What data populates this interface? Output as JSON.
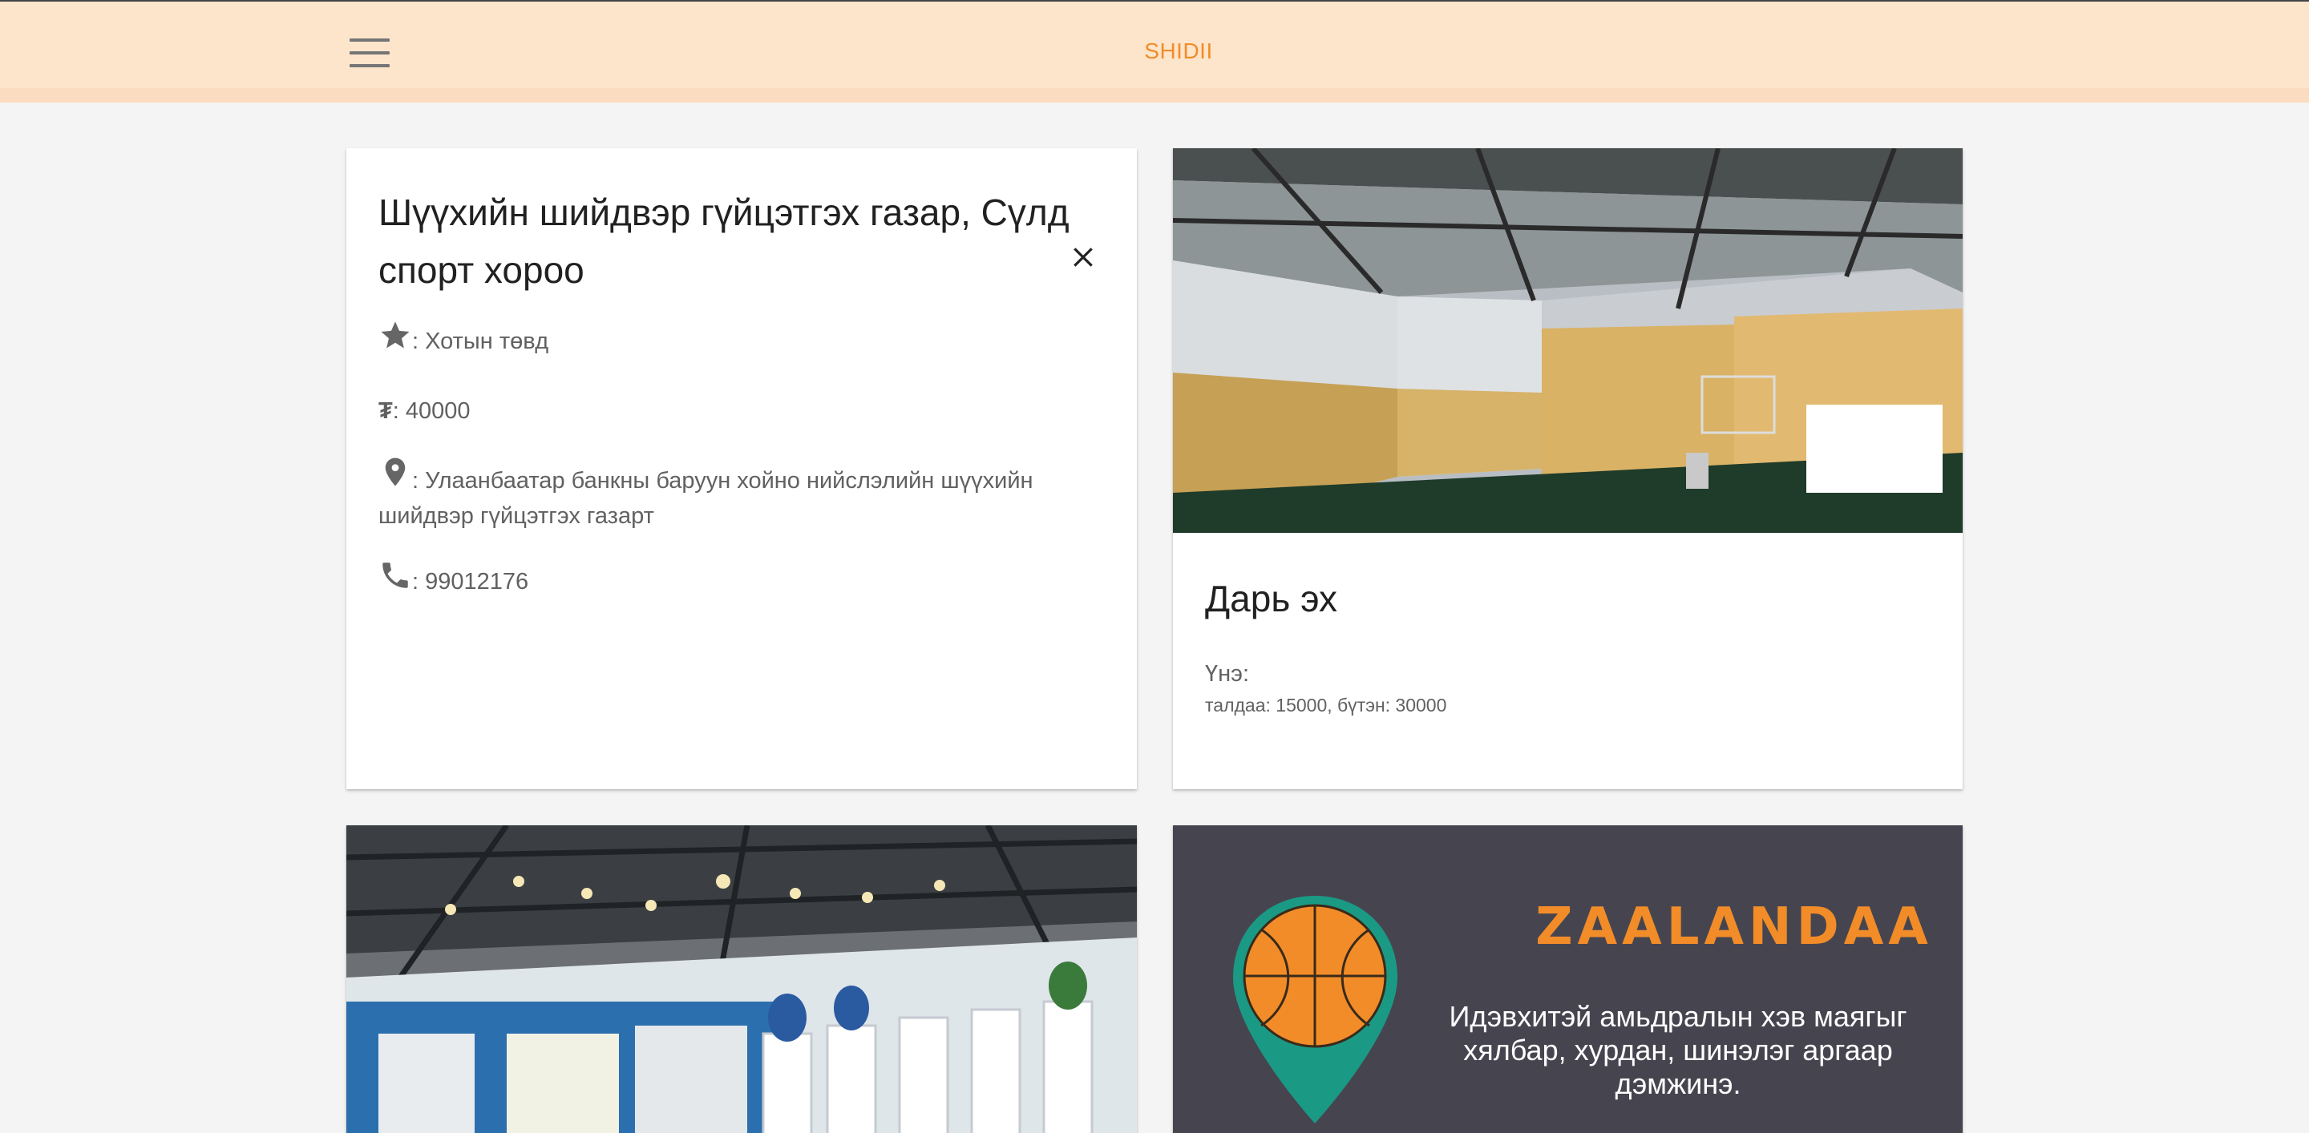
{
  "header": {
    "brand": "SHIDII",
    "menu_icon": "hamburger-menu-icon"
  },
  "detail_card": {
    "title": "Шүүхийн шийдвэр гүйцэтгэх газар, Сүлд спорт хороо",
    "close_icon": "close-icon",
    "rating_value": ": Хотын төвд",
    "price_value": ": 40000",
    "address_value": ": Улаанбаатар банкны баруун хойно нийслэлийн шүүхийн шийдвэр гүйцэтгэх газарт",
    "phone_value": ": 99012176",
    "icons": [
      "star-icon",
      "tugrik-icon",
      "location-pin-icon",
      "phone-icon"
    ],
    "currency_symbol": "₮"
  },
  "hall_card": {
    "name": "Дарь эх",
    "price_label": "Үнэ:",
    "price_value": "талдаа: 15000, бүтэн: 30000"
  },
  "promo_card": {
    "logo_text": "ZAALANDAA",
    "tagline": "Идэвхитэй амьдралын хэв маягыг хялбар, хурдан, шинэлэг аргаар дэмжинэ.",
    "colors": {
      "background": "#46454f",
      "accent": "#f28c28",
      "pin": "#1a9a84"
    }
  },
  "colors": {
    "header_bg": "#fde5cc",
    "brand": "#f28c28",
    "page_bg": "#f4f4f4"
  }
}
